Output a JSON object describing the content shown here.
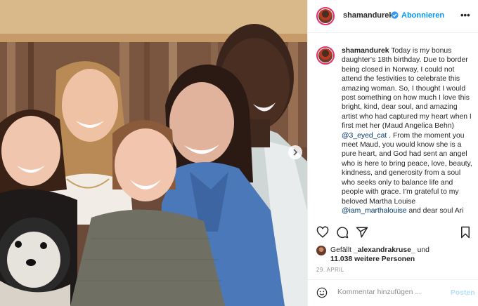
{
  "post": {
    "username": "shamandurek",
    "follow_label": "Abonnieren",
    "more_label": "•••",
    "caption_username": "shamandurek",
    "caption_part1": " Today is my bonus daughter's 18th birthday. Due to border being closed in Norway, I could not attend the festivities to celebrate this amazing woman. So, I thought I would post something on how much I love this bright, kind, dear soul, and amazing artist who had captured my heart when I first met her (Maud Angelica Behn) ",
    "mention1": "@3_eyed_cat",
    "caption_part2": " . From the moment you meet Maud, you would know she is a pure heart, and God had sent an angel who is here to bring peace, love, beauty, kindness, and generosity from a soul who seeks only to balance life and people with grace. I'm grateful to my beloved Martha Louise ",
    "mention2": "@iam_marthalouise",
    "caption_part3": " and dear soul Ari",
    "likes_prefix": "Gefällt ",
    "likes_user": "_alexandrakruse_",
    "likes_mid": " und",
    "likes_count": "11.038 weitere Personen",
    "date": "29. APRIL"
  },
  "comment": {
    "placeholder": "Kommentar hinzufügen ...",
    "post_label": "Posten"
  },
  "icons": [
    "verified-badge-icon",
    "heart-icon",
    "comment-icon",
    "share-icon",
    "bookmark-icon",
    "smiley-icon",
    "chevron-right-icon"
  ],
  "colors": {
    "link": "#0095f6",
    "verified": "#3897f0",
    "mention": "#00376b",
    "post_disabled": "#b2dffc",
    "muted": "#8e8e8e",
    "story_ring": "#e1306c"
  }
}
